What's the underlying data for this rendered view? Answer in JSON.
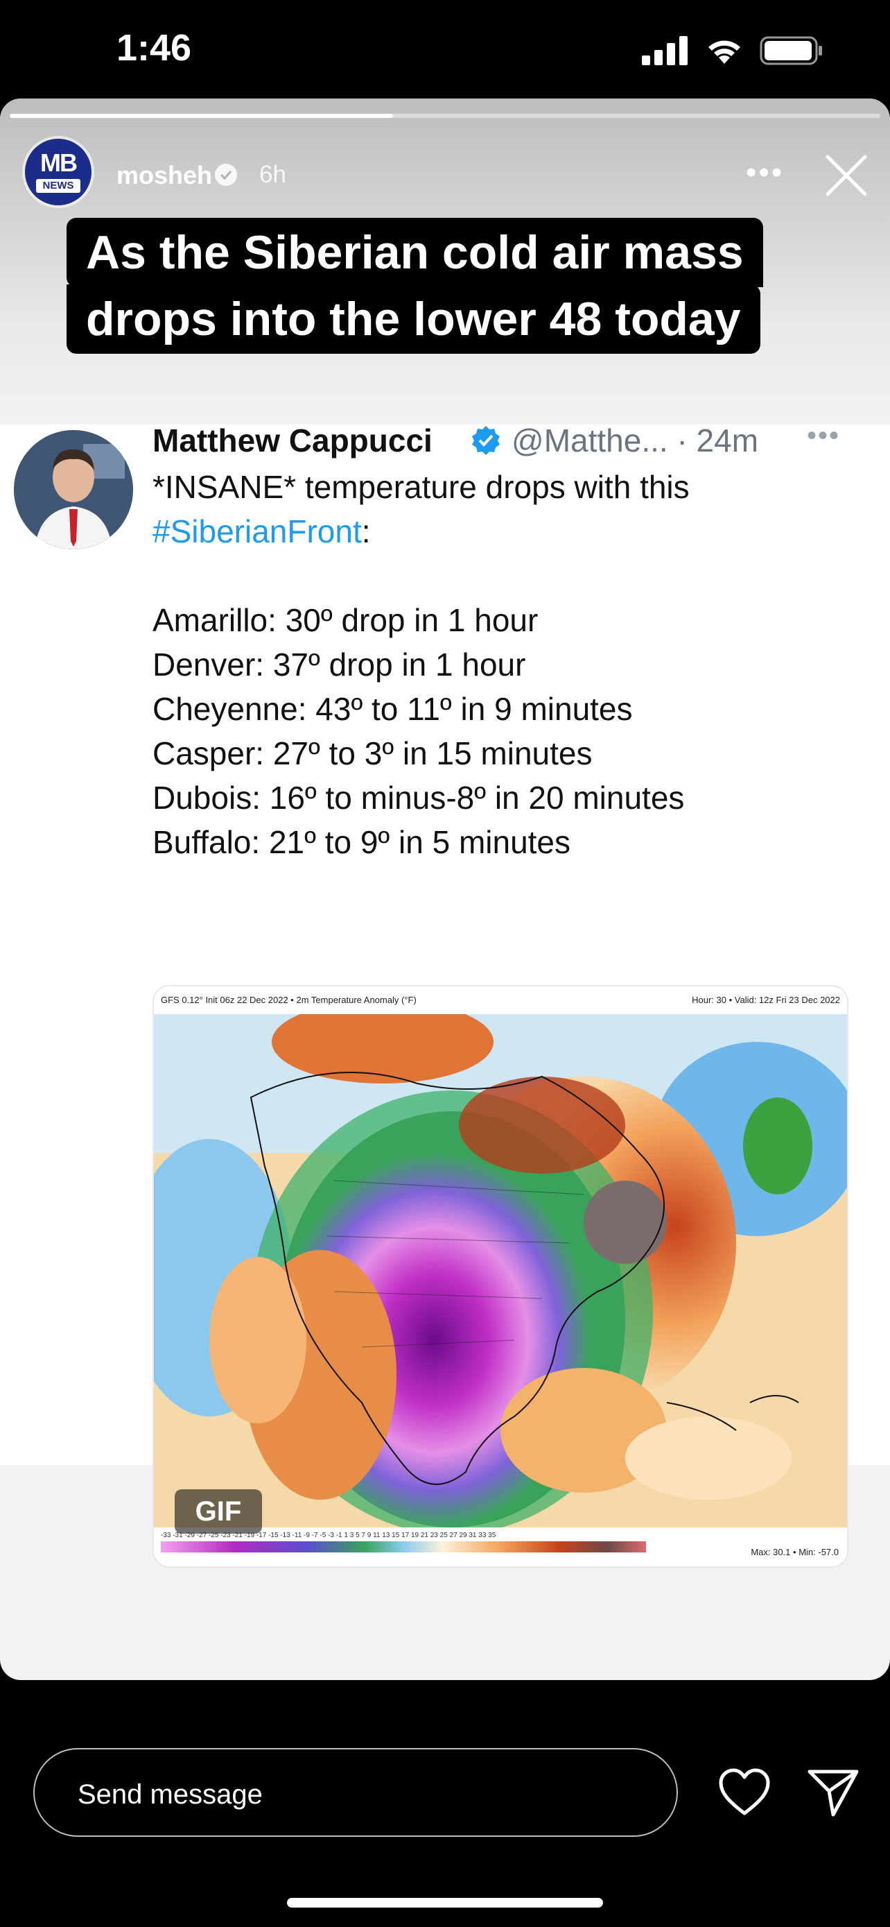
{
  "status_bar": {
    "time": "1:46"
  },
  "story": {
    "progress": 0.44,
    "account": {
      "avatar_text": "MB",
      "avatar_subtext": "NEWS",
      "username": "mosheh",
      "time_ago": "6h"
    },
    "caption_lines": [
      "As the Siberian cold air mass",
      "drops into the lower 48 today"
    ]
  },
  "tweet": {
    "author_name": "Matthew Cappucci",
    "handle_time": "@Matthe... · 24m",
    "text_lines": [
      {
        "pre": "*INSANE* temperature drops with this",
        "tag": ""
      },
      {
        "pre": "",
        "tag": "#SiberianFront",
        "post": ":"
      }
    ],
    "stats": [
      "Amarillo: 30º drop in 1 hour",
      "Denver: 37º drop in 1 hour",
      "Cheyenne: 43º to 11º in 9 minutes",
      "Casper: 27º to 3º in 15 minutes",
      "Dubois: 16º to minus-8º in 20 minutes",
      "Buffalo: 21º to 9º in 5 minutes"
    ],
    "media": {
      "header_left": "GFS 0.12° Init 06z 22 Dec 2022 • 2m Temperature Anomaly (°F)",
      "header_right": "Hour: 30 • Valid: 12z Fri 23 Dec 2022",
      "badge": "GIF",
      "legend_ticks": "-33 -31 -29 -27 -25 -23 -21 -19 -17 -15 -13 -11 -9 -7 -5 -3 -1 1 3 5 7 9 11 13 15 17 19 21 23 25 27 29 31 33 35",
      "minmax": "Max: 30.1 • Min: -57.0"
    }
  },
  "footer": {
    "message_placeholder": "Send message"
  },
  "colors": {
    "verified": "#1d9bf0",
    "hashtag": "#1d9bf0",
    "mb_blue": "#1b2c8a"
  }
}
